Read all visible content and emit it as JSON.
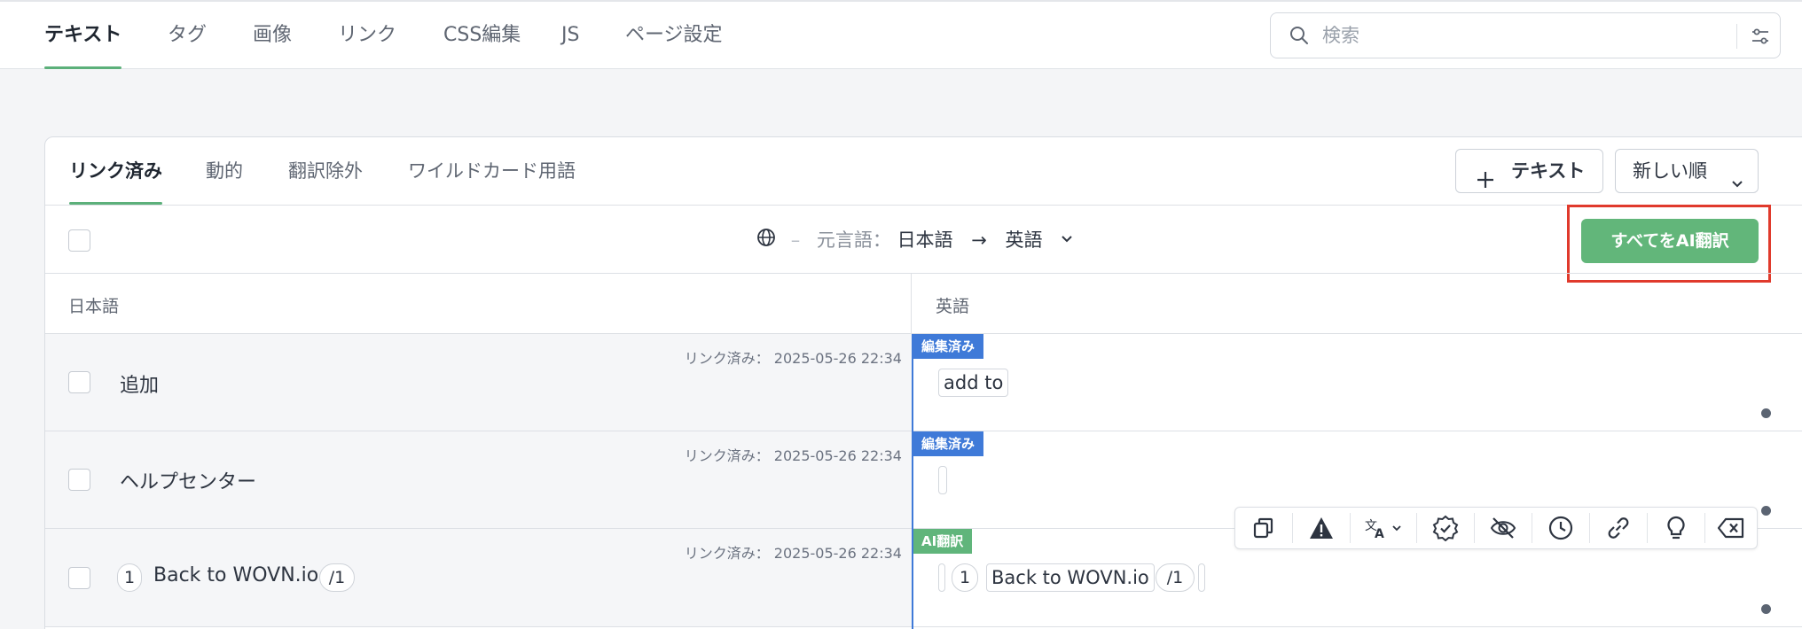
{
  "top_nav": {
    "tabs": [
      {
        "label": "テキスト",
        "active": true
      },
      {
        "label": "タグ"
      },
      {
        "label": "画像"
      },
      {
        "label": "リンク"
      },
      {
        "label": "CSS編集"
      },
      {
        "label": "JS"
      },
      {
        "label": "ページ設定"
      }
    ],
    "search": {
      "placeholder": "検索",
      "icon": "search-icon",
      "filter_icon": "sliders-icon"
    }
  },
  "panel": {
    "tabs": [
      {
        "label": "リンク済み",
        "active": true
      },
      {
        "label": "動的"
      },
      {
        "label": "翻訳除外"
      },
      {
        "label": "ワイルドカード用語"
      }
    ],
    "add_text_button": {
      "icon": "plus-icon",
      "label": "テキスト"
    },
    "sort_select": {
      "value": "新しい順"
    },
    "language_bar": {
      "dash": "–",
      "source_prefix": "元言語：",
      "source_language": "日本語",
      "arrow": "→",
      "target_language": "英語"
    },
    "ai_translate_all_button": "すべてをAI翻訳",
    "columns": {
      "source": "日本語",
      "target": "英語"
    },
    "rows": [
      {
        "stamp": "リンク済み： 2025-05-26 22:34",
        "source": "追加",
        "badge": "編集済み",
        "badge_color": "#3f7ad8",
        "translation": "add to"
      },
      {
        "stamp": "リンク済み： 2025-05-26 22:34",
        "source": "ヘルプセンター",
        "badge": "編集済み",
        "badge_color": "#3f7ad8",
        "translation": ""
      },
      {
        "stamp": "リンク済み： 2025-05-26 22:34",
        "source_tag_open": "1",
        "source": "Back to WOVN.io",
        "source_tag_close": "/1",
        "badge": "AI翻訳",
        "badge_color": "#60b57b",
        "translation_tag_open": "1",
        "translation": "Back to WOVN.io",
        "translation_tag_close": "/1"
      }
    ]
  },
  "toolbar": {
    "icons": [
      "copy-icon",
      "warning-icon",
      "translate-icon",
      "verified-badge-icon",
      "eye-off-icon",
      "history-icon",
      "link-icon",
      "lightbulb-icon",
      "backspace-icon"
    ]
  },
  "colors": {
    "accent_green": "#5cb07a",
    "edited_blue": "#3f7ad8",
    "highlight_red": "#e03a2c"
  }
}
